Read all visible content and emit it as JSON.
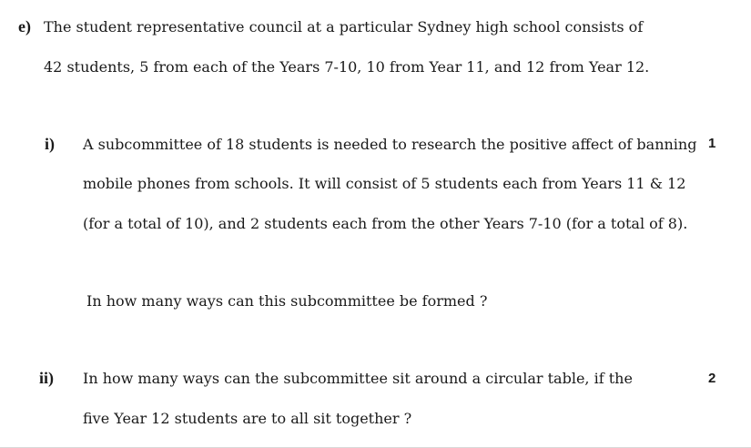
{
  "question_e": {
    "label": "e)",
    "intro_line1": "The student representative council at a particular Sydney high school consists of",
    "intro_line2": "42 students, 5 from each of the Years 7-10, 10 from Year 11, and 12 from Year 12."
  },
  "part_i": {
    "label": "i)",
    "marks": "1",
    "line1": "A subcommittee of 18 students is needed to research the positive affect of banning",
    "line2": "mobile phones from schools. It will consist of 5 students each from Years 11 & 12",
    "line3": "(for a total of 10), and 2 students each from the other Years 7-10 (for a total of 8).",
    "question": "In how many ways can this subcommittee be formed ?"
  },
  "part_ii": {
    "label": "ii)",
    "marks": "2",
    "line1": "In how many ways can the subcommittee sit around a circular table, if the",
    "line2": "five Year 12 students are to all sit together ?"
  }
}
